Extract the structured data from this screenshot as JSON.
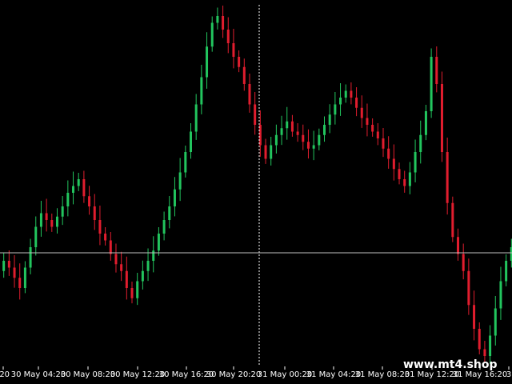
{
  "app": {
    "watermark": "www.mt4.shop"
  },
  "chart_data": {
    "type": "candlestick",
    "title": "",
    "xlabel": "",
    "ylabel": "",
    "grid": false,
    "colors": {
      "background": "#000000",
      "bull": "#22c55e",
      "bear": "#e11d2e",
      "crosshair": "#ffffff",
      "axis_text": "#ffffff",
      "horizontal_line": "#bfbfbf"
    },
    "x_tick_labels": [
      ":20",
      "30 May 04:20",
      "30 May 08:20",
      "30 May 12:20",
      "30 May 16:20",
      "30 May 20:20",
      "31 May 00:20",
      "31 May 04:20",
      "31 May 08:20",
      "31 May 12:20",
      "31 May 16:20",
      "3"
    ],
    "closes": [
      55,
      58,
      56,
      53,
      50,
      56,
      62,
      68,
      72,
      70,
      68,
      71,
      74,
      78,
      80,
      82,
      77,
      74,
      70,
      66,
      64,
      60,
      57,
      55,
      50,
      47,
      52,
      55,
      58,
      61,
      66,
      70,
      74,
      79,
      84,
      90,
      96,
      104,
      112,
      121,
      128,
      130,
      126,
      122,
      118,
      115,
      110,
      104,
      98,
      92,
      88,
      92,
      95,
      97,
      99,
      96,
      95,
      93,
      91,
      92,
      95,
      98,
      101,
      104,
      106,
      108,
      106,
      103,
      100,
      98,
      96,
      94,
      91,
      88,
      85,
      82,
      80,
      84,
      90,
      95,
      102,
      118,
      110,
      90,
      75,
      65,
      60,
      55,
      45,
      38,
      32,
      30,
      36,
      44,
      52,
      58,
      62
    ]
  }
}
